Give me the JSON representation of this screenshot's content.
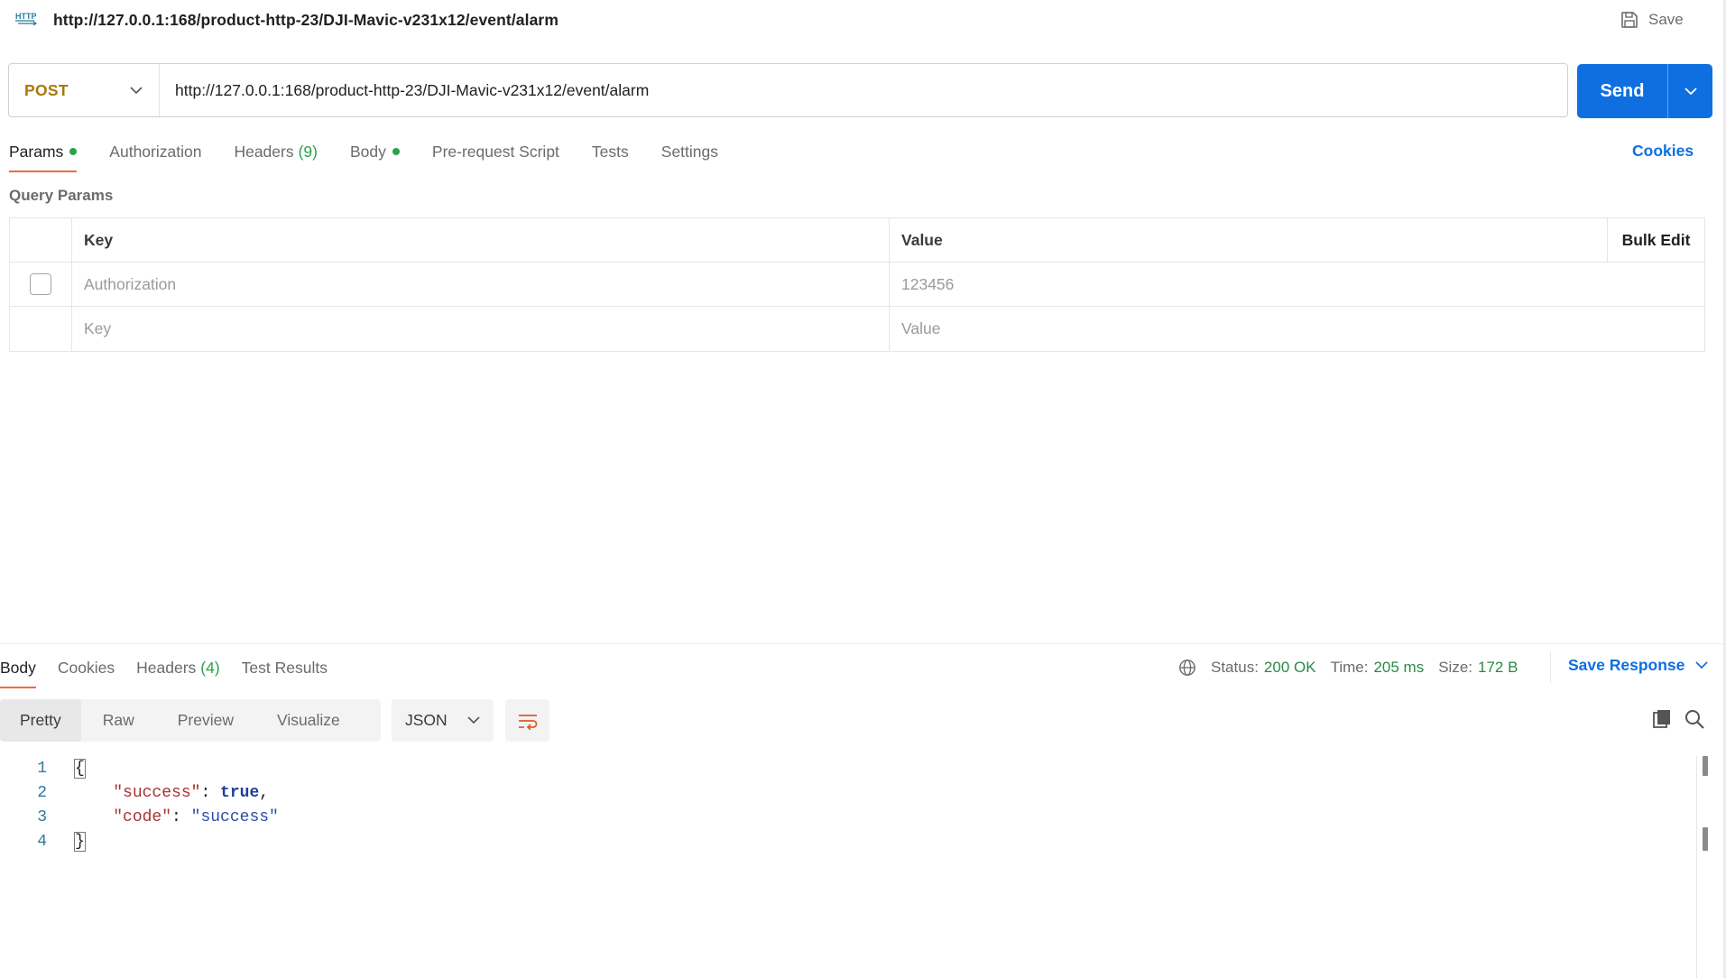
{
  "header": {
    "icon": "http-icon",
    "url_title": "http://127.0.0.1:168/product-http-23/DJI-Mavic-v231x12/event/alarm",
    "save_label": "Save"
  },
  "request": {
    "method": "POST",
    "url": "http://127.0.0.1:168/product-http-23/DJI-Mavic-v231x12/event/alarm",
    "send_label": "Send"
  },
  "request_tabs": [
    {
      "label": "Params",
      "indicator": "dot"
    },
    {
      "label": "Authorization"
    },
    {
      "label": "Headers",
      "count": "(9)"
    },
    {
      "label": "Body",
      "indicator": "dot"
    },
    {
      "label": "Pre-request Script"
    },
    {
      "label": "Tests"
    },
    {
      "label": "Settings"
    }
  ],
  "cookies_link": "Cookies",
  "query_params": {
    "title": "Query Params",
    "headers": {
      "key": "Key",
      "value": "Value",
      "bulk_edit": "Bulk Edit"
    },
    "rows": [
      {
        "key": "Authorization",
        "value": "123456",
        "checked": false
      }
    ],
    "placeholder": {
      "key": "Key",
      "value": "Value"
    }
  },
  "response_tabs": [
    {
      "label": "Body"
    },
    {
      "label": "Cookies"
    },
    {
      "label": "Headers",
      "count": "(4)"
    },
    {
      "label": "Test Results"
    }
  ],
  "response_status": {
    "status_label": "Status:",
    "status_value": "200 OK",
    "time_label": "Time:",
    "time_value": "205 ms",
    "size_label": "Size:",
    "size_value": "172 B",
    "save_response": "Save Response"
  },
  "view_modes": [
    "Pretty",
    "Raw",
    "Preview",
    "Visualize"
  ],
  "format": "JSON",
  "code": {
    "line_numbers": [
      "1",
      "2",
      "3",
      "4"
    ],
    "open_brace": "{",
    "close_brace": "}",
    "key1": "\"success\"",
    "val1": "true",
    "key2": "\"code\"",
    "val2": "\"success\""
  },
  "colors": {
    "accent": "#0f6fe0",
    "method": "#a8780a",
    "active_tab_underline": "#f26b3a",
    "status_ok": "#2a8a46",
    "indicator_dot": "#2aa24a"
  }
}
